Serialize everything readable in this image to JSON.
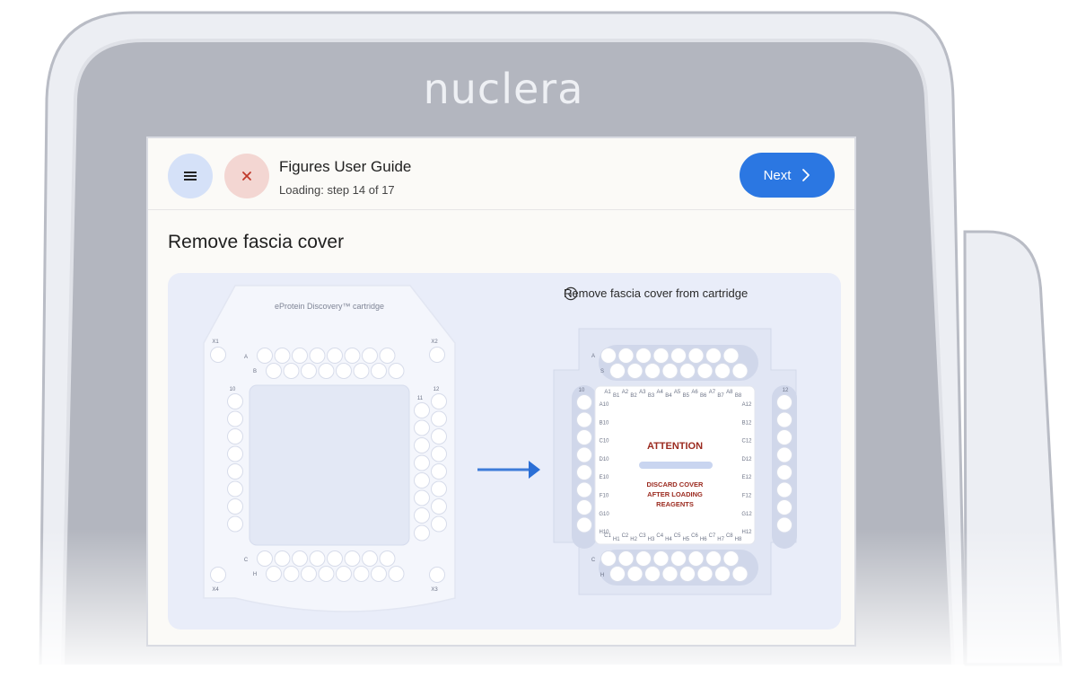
{
  "brand": {
    "logo_text": "nuclera"
  },
  "header": {
    "title": "Figures User Guide",
    "status": "Loading: step 14 of 17",
    "next_label": "Next",
    "menu_icon": "hamburger-icon",
    "close_icon": "close-icon"
  },
  "page": {
    "title": "Remove fascia cover"
  },
  "illustration": {
    "info_text": "Remove fascia cover from cartridge",
    "info_icon": "info-icon",
    "left_cartridge": {
      "label": "eProtein Discovery™ cartridge",
      "corner_labels": [
        "X1",
        "X2",
        "X4",
        "X3"
      ],
      "row_labels_top": [
        "A",
        "B"
      ],
      "row_labels_bottom": [
        "C",
        "H"
      ],
      "column_labels": [
        "10",
        "11",
        "12"
      ]
    },
    "right_cartridge": {
      "row_labels_top": [
        "A",
        "S"
      ],
      "row_labels_bottom": [
        "C",
        "H"
      ],
      "side_labels": [
        "10",
        "12"
      ],
      "top_well_labels": [
        "A1",
        "B1",
        "A2",
        "B2",
        "A3",
        "B3",
        "A4",
        "B4",
        "A5",
        "B5",
        "A6",
        "B6",
        "A7",
        "B7",
        "A8",
        "B8"
      ],
      "bottom_well_labels": [
        "C1",
        "H1",
        "C2",
        "H2",
        "C3",
        "H3",
        "C4",
        "H4",
        "C5",
        "H5",
        "C6",
        "H6",
        "C7",
        "H7",
        "C8",
        "H8"
      ],
      "left_well_labels": [
        "A10",
        "B10",
        "C10",
        "D10",
        "E10",
        "F10",
        "G10",
        "H10"
      ],
      "right_well_labels": [
        "A12",
        "B12",
        "C12",
        "D12",
        "E12",
        "F12",
        "G12",
        "H12"
      ],
      "attention_title": "ATTENTION",
      "attention_lines": [
        "DISCARD COVER",
        "AFTER LOADING",
        "REAGENTS"
      ]
    },
    "arrow_icon": "arrow-right-icon"
  },
  "colors": {
    "accent": "#2b77e2",
    "attention": "#9b2a1f",
    "menu_bg": "#d5e1f8",
    "close_bg": "#f3d6d2"
  }
}
